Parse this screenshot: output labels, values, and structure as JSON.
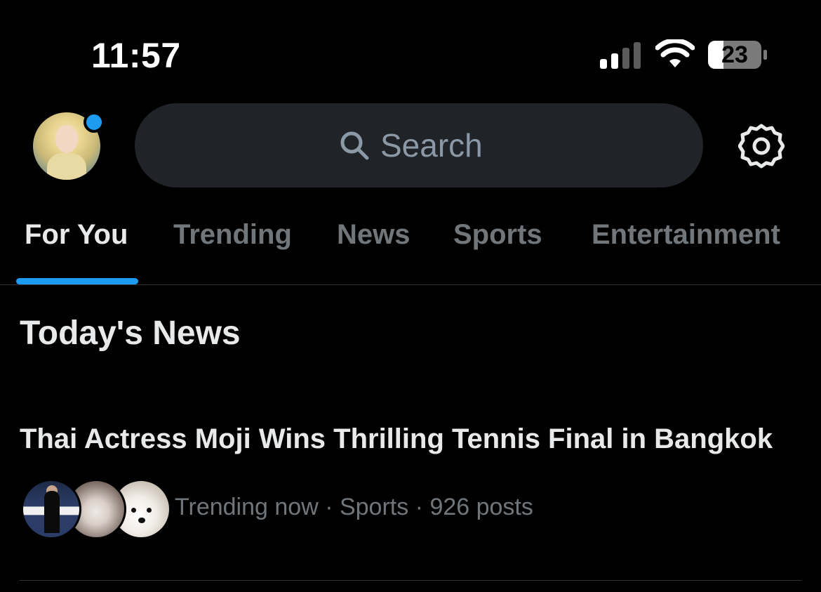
{
  "status_bar": {
    "time": "11:57",
    "battery": "23",
    "signal_bars_filled": 2,
    "signal_bars_total": 4
  },
  "header": {
    "search_placeholder": "Search",
    "has_notification": true,
    "accent_color": "#1d9bf0"
  },
  "tabs": [
    {
      "label": "For You",
      "active": true
    },
    {
      "label": "Trending",
      "active": false
    },
    {
      "label": "News",
      "active": false
    },
    {
      "label": "Sports",
      "active": false
    },
    {
      "label": "Entertainment",
      "active": false
    }
  ],
  "section": {
    "title": "Today's News"
  },
  "news_items": [
    {
      "headline": "Thai Actress Moji Wins Thrilling Tennis Final in Bangkok",
      "meta": "Trending now · Sports · 926 posts"
    }
  ],
  "icons": [
    "search-icon",
    "gear-icon",
    "wifi-icon",
    "cellular-signal-icon",
    "battery-icon"
  ]
}
